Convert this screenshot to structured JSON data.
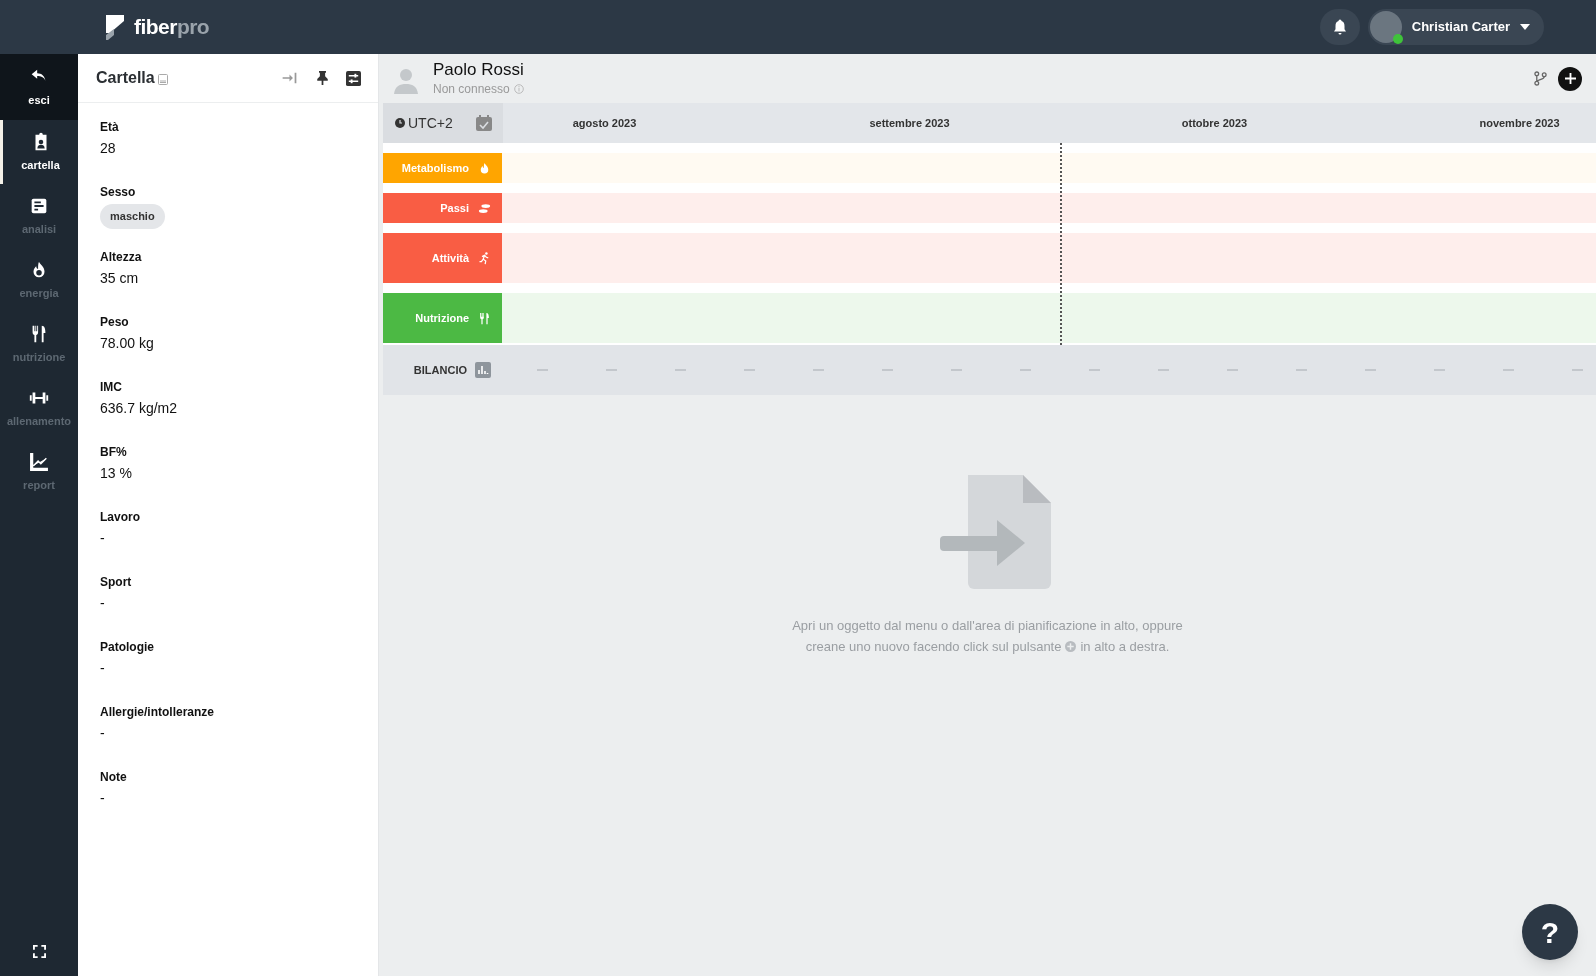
{
  "topbar": {
    "logo_text": "fiber",
    "logo_text_accent": "pro",
    "user_name": "Christian Carter",
    "user_online": true
  },
  "nav": [
    {
      "label": "esci",
      "kind": "back",
      "selected": false
    },
    {
      "label": "cartella",
      "kind": "folder",
      "selected": true
    },
    {
      "label": "analisi",
      "kind": "analysis",
      "selected": false
    },
    {
      "label": "energia",
      "kind": "energy",
      "selected": false
    },
    {
      "label": "nutrizione",
      "kind": "nutrition",
      "selected": false
    },
    {
      "label": "allenamento",
      "kind": "training",
      "selected": false
    },
    {
      "label": "report",
      "kind": "report",
      "selected": false
    }
  ],
  "panel": {
    "title": "Cartella",
    "fields": [
      {
        "label": "Età",
        "value": "28",
        "kind": "text"
      },
      {
        "label": "Sesso",
        "value": "maschio",
        "kind": "chip"
      },
      {
        "label": "Altezza",
        "value": "35 cm",
        "kind": "text"
      },
      {
        "label": "Peso",
        "value": "78.00 kg",
        "kind": "text"
      },
      {
        "label": "IMC",
        "value": "636.7 kg/m2",
        "kind": "text"
      },
      {
        "label": "BF%",
        "value": "13 %",
        "kind": "text"
      },
      {
        "label": "Lavoro",
        "value": "-",
        "kind": "text"
      },
      {
        "label": "Sport",
        "value": "-",
        "kind": "text"
      },
      {
        "label": "Patologie",
        "value": "-",
        "kind": "text"
      },
      {
        "label": "Allergie/intolleranze",
        "value": "-",
        "kind": "text"
      },
      {
        "label": "Note",
        "value": "-",
        "kind": "text"
      }
    ]
  },
  "client": {
    "name": "Paolo Rossi",
    "status": "Non connesso"
  },
  "timeline": {
    "timezone": "UTC+2",
    "months": [
      "agosto 2023",
      "settembre 2023",
      "ottobre 2023",
      "novembre 2023"
    ],
    "rows": [
      {
        "label": "Metabolismo",
        "kind": "metabolism",
        "color": "#ffa500",
        "tall": false
      },
      {
        "label": "Passi",
        "kind": "steps",
        "color": "#f95d44",
        "tall": false
      },
      {
        "label": "Attività",
        "kind": "activity",
        "color": "#f95d44",
        "tall": true
      },
      {
        "label": "Nutrizione",
        "kind": "nutrition",
        "color": "#4cb944",
        "tall": true
      }
    ],
    "balance_label": "BILANCIO"
  },
  "empty_state": {
    "text_line_1": "Apri un oggetto dal menu o dall'area di pianificazione in alto, oppure",
    "text_before_icon": "creane uno nuovo facendo click sul pulsante",
    "text_after_icon": "in alto a destra."
  },
  "help_button": "?"
}
